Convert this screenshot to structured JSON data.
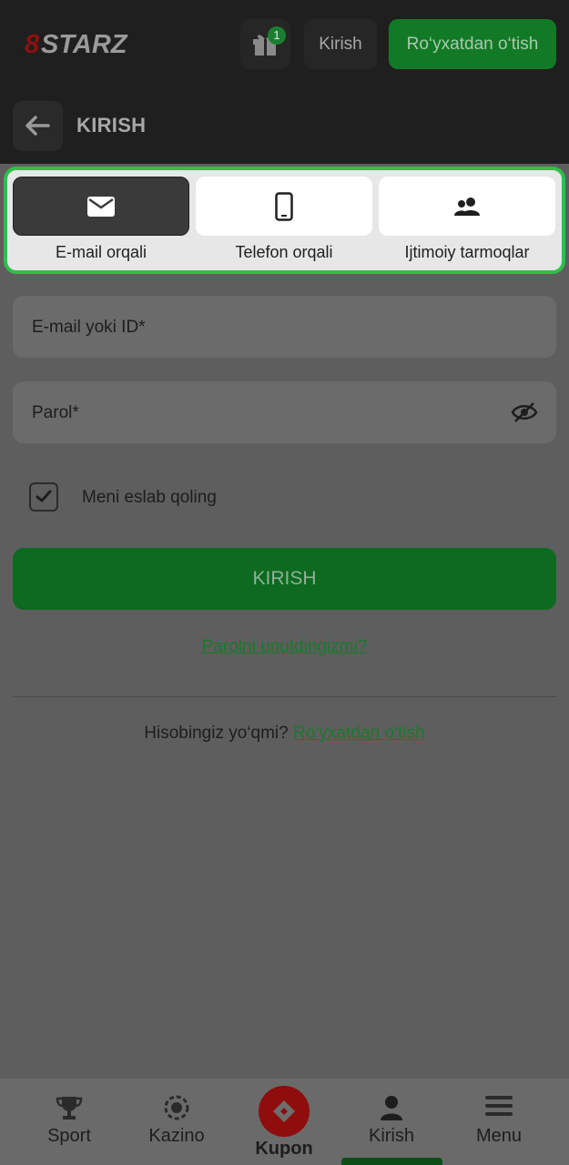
{
  "header": {
    "logo_text": "8STARZ",
    "gift_badge_count": "1",
    "login_label": "Kirish",
    "register_label": "Ro‘yxatdan o‘tish"
  },
  "subheader": {
    "title": "KIRISH"
  },
  "login_methods": [
    {
      "label": "E-mail orqali",
      "icon": "envelope-icon",
      "active": true
    },
    {
      "label": "Telefon orqali",
      "icon": "phone-icon",
      "active": false
    },
    {
      "label": "Ijtimoiy tarmoqlar",
      "icon": "users-icon",
      "active": false
    }
  ],
  "form": {
    "email_placeholder": "E-mail yoki ID*",
    "password_placeholder": "Parol*",
    "remember_label": "Meni eslab qoling",
    "remember_checked": true,
    "submit_label": "KIRISH",
    "forgot_label": "Parolni unutdingizmi?",
    "no_account_text": "Hisobingiz yo‘qmi?",
    "signup_link_label": "Ro‘yxatdan o‘tish"
  },
  "bottom_nav": [
    {
      "label": "Sport",
      "icon": "trophy-icon"
    },
    {
      "label": "Kazino",
      "icon": "casino-chip-icon"
    },
    {
      "label": "Kupon",
      "icon": "ticket-icon"
    },
    {
      "label": "Kirish",
      "icon": "user-icon",
      "active": true
    },
    {
      "label": "Menu",
      "icon": "hamburger-icon"
    }
  ],
  "colors": {
    "accent_green": "#127a26",
    "highlight_border": "#2fbf4a",
    "coupon_red": "#8f0d0d",
    "header_bg": "#1f1f1f"
  }
}
